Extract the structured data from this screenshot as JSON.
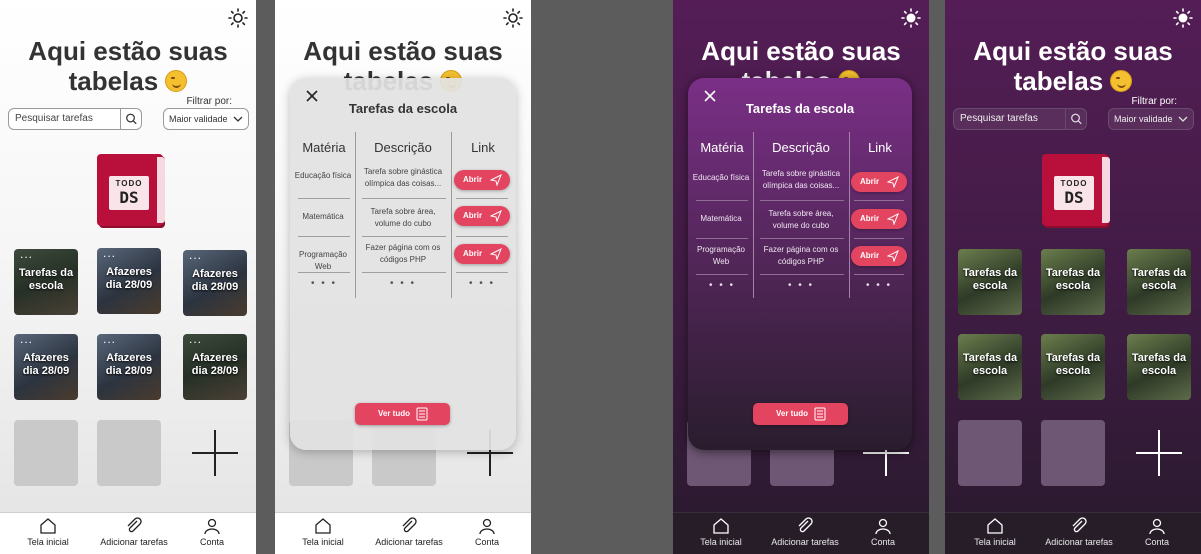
{
  "screens": [
    {
      "id": "light-home",
      "theme": "light",
      "modal": false
    },
    {
      "id": "light-modal",
      "theme": "light",
      "modal": true
    },
    {
      "id": "dark-modal",
      "theme": "dark",
      "modal": true
    },
    {
      "id": "dark-home",
      "theme": "dark",
      "modal": false
    }
  ],
  "home": {
    "title_line1": "Aqui estão suas",
    "title_line2": "tabelas",
    "title_emoji": "winking-face",
    "search_placeholder": "Pesquisar tarefas",
    "filter_label": "Filtrar por:",
    "filter_value": "Maior validade",
    "logo_line1": "TODO",
    "logo_line2": "DS",
    "card_menu": "...",
    "light_cards": [
      "Tarefas da escola",
      "Afazeres dia 28/09",
      "Afazeres dia 28/09",
      "Afazeres dia 28/09",
      "Afazeres dia 28/09",
      "Afazeres dia 28/09"
    ],
    "dark_cards": [
      "Tarefas da escola",
      "Tarefas da escola",
      "Tarefas da escola",
      "Tarefas da escola",
      "Tarefas da escola",
      "Tarefas da escola"
    ]
  },
  "nav": {
    "home": "Tela inicial",
    "add": "Adicionar tarefas",
    "account": "Conta"
  },
  "modal": {
    "title": "Tarefas da escola",
    "headers": [
      "Matéria",
      "Descrição",
      "Link"
    ],
    "rows": [
      {
        "materia": "Educação física",
        "descricao": "Tarefa sobre ginástica olímpica das coisas...",
        "link": "Abrir"
      },
      {
        "materia": "Matemática",
        "descricao": "Tarefa sobre área, volume do cubo",
        "link": "Abrir"
      },
      {
        "materia": "Programação Web",
        "descricao": "Fazer página com os códigos PHP",
        "link": "Abrir"
      }
    ],
    "more": "• • •",
    "see_all": "Ver tudo"
  },
  "colors": {
    "accent": "#e34460",
    "dark_bg": "#541d56",
    "light_bg": "#ffffff"
  }
}
